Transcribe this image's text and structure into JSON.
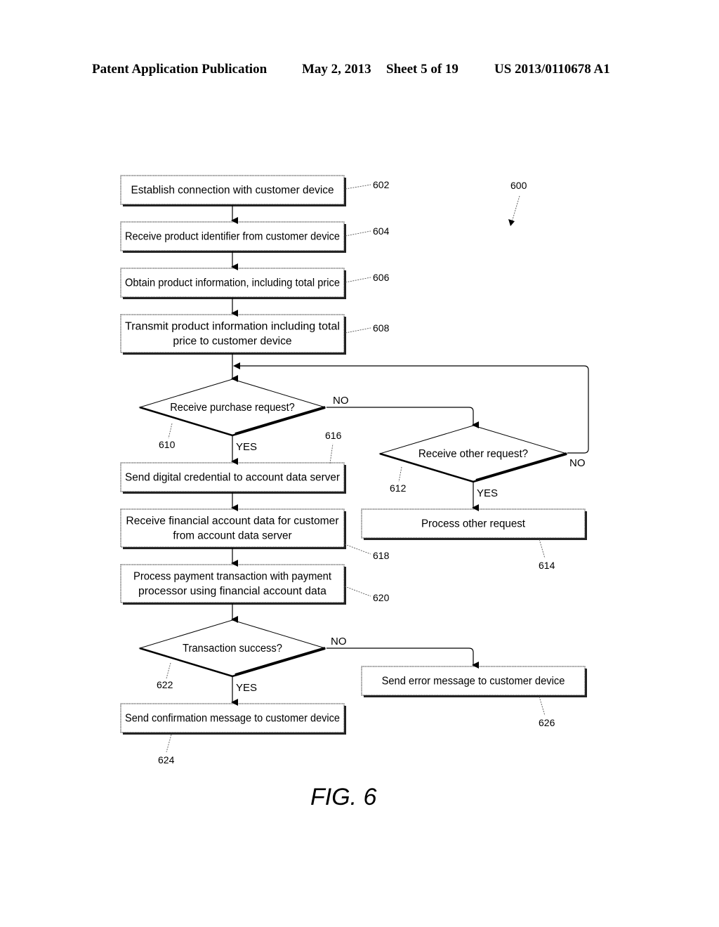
{
  "header": {
    "publication": "Patent Application Publication",
    "date": "May 2, 2013",
    "sheet": "Sheet 5 of 19",
    "number": "US 2013/0110678 A1"
  },
  "figure": {
    "label": "FIG. 6",
    "ref": "600"
  },
  "steps": {
    "s602": {
      "ref": "602",
      "lines": [
        "Establish connection with customer device"
      ]
    },
    "s604": {
      "ref": "604",
      "lines": [
        "Receive product identifier from customer device"
      ]
    },
    "s606": {
      "ref": "606",
      "lines": [
        "Obtain product information, including total price"
      ]
    },
    "s608": {
      "ref": "608",
      "lines": [
        "Transmit product information including total",
        "price to customer device"
      ]
    },
    "s616": {
      "ref": "616",
      "lines": [
        "Send digital credential to account data server"
      ]
    },
    "s618": {
      "ref": "618",
      "lines": [
        "Receive financial account data for customer",
        "from account data server"
      ]
    },
    "s620": {
      "ref": "620",
      "lines": [
        "Process payment transaction with payment",
        "processor using financial account data"
      ]
    },
    "s614": {
      "ref": "614",
      "lines": [
        "Process other request"
      ]
    },
    "s624": {
      "ref": "624",
      "lines": [
        "Send confirmation message to customer device"
      ]
    },
    "s626": {
      "ref": "626",
      "lines": [
        "Send error message to customer device"
      ]
    }
  },
  "decisions": {
    "d610": {
      "ref": "610",
      "text": "Receive purchase request?",
      "yes": "YES",
      "no": "NO"
    },
    "d612": {
      "ref": "612",
      "text": "Receive other request?",
      "yes": "YES",
      "no": "NO"
    },
    "d622": {
      "ref": "622",
      "text": "Transaction success?",
      "yes": "YES",
      "no": "NO"
    }
  }
}
